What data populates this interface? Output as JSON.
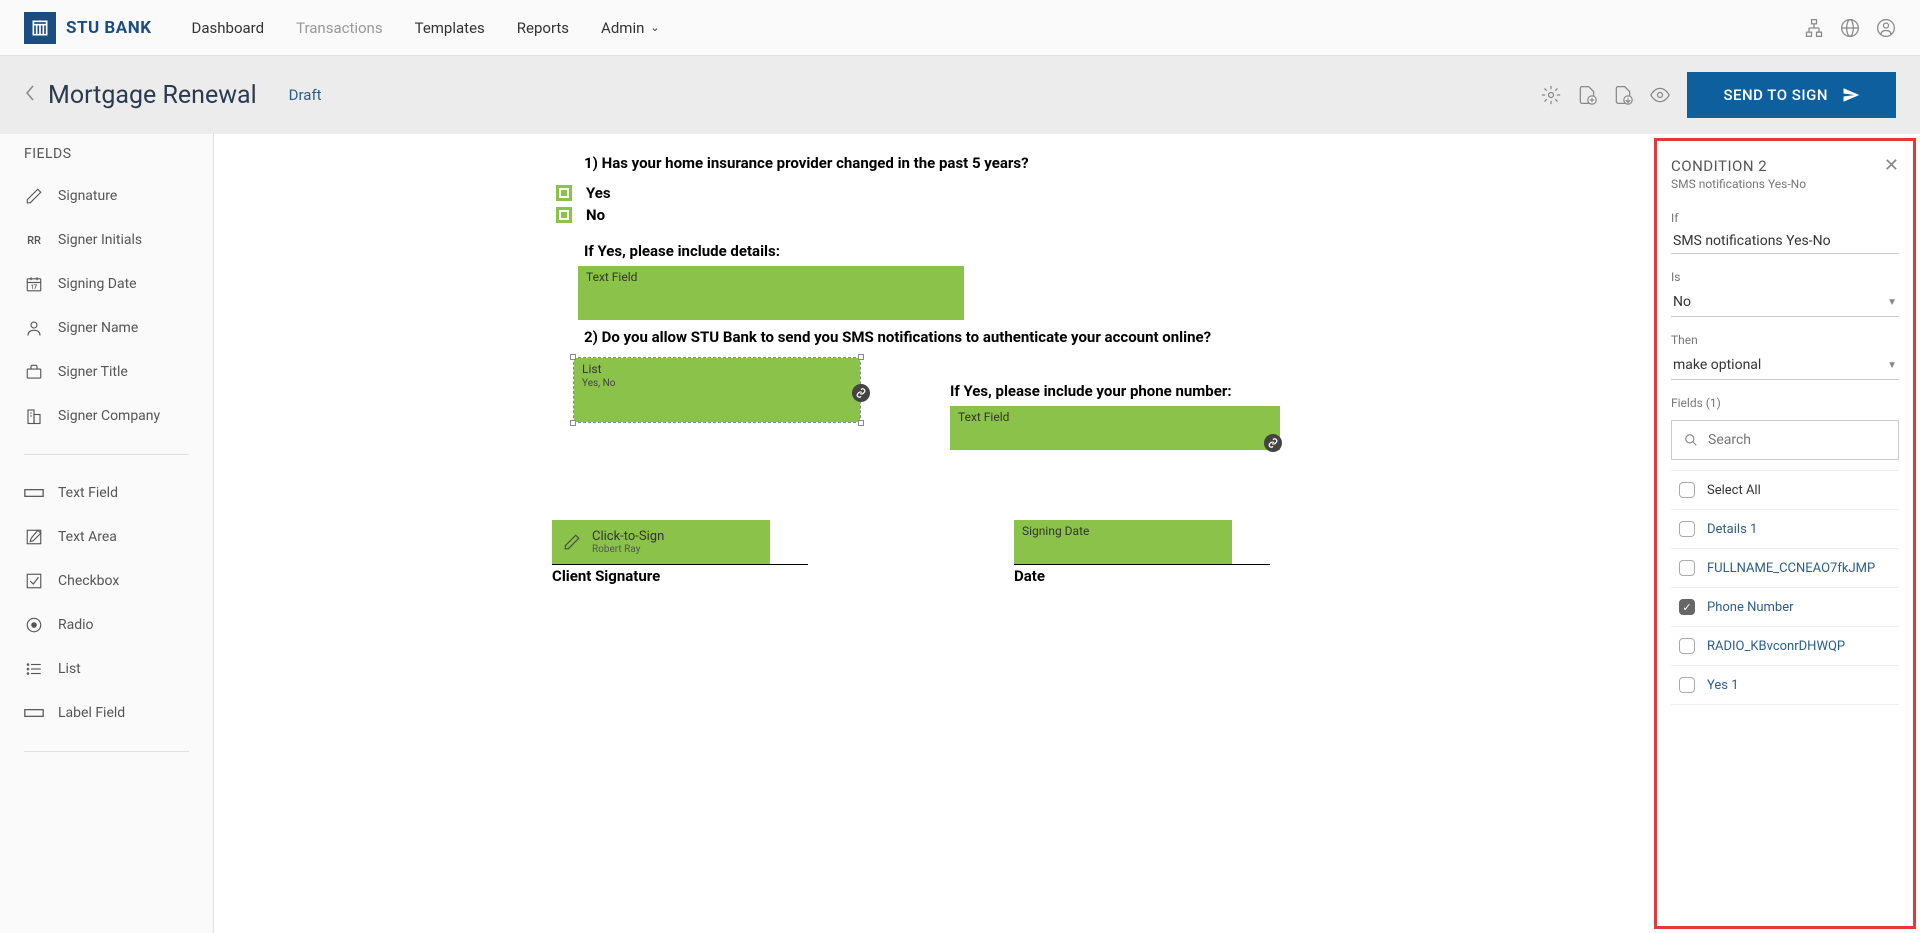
{
  "logo": {
    "text": "STU BANK"
  },
  "nav": {
    "items": [
      "Dashboard",
      "Transactions",
      "Templates",
      "Reports",
      "Admin"
    ],
    "active_index": 1
  },
  "sub_header": {
    "title": "Mortgage Renewal",
    "status": "Draft",
    "send_button": "SEND TO SIGN"
  },
  "sidebar": {
    "header": "FIELDS",
    "group1": [
      {
        "label": "Signature",
        "icon": "pencil"
      },
      {
        "label": "Signer Initials",
        "icon": "initials"
      },
      {
        "label": "Signing Date",
        "icon": "calendar"
      },
      {
        "label": "Signer Name",
        "icon": "person"
      },
      {
        "label": "Signer Title",
        "icon": "briefcase"
      },
      {
        "label": "Signer Company",
        "icon": "company"
      }
    ],
    "group2": [
      {
        "label": "Text Field",
        "icon": "textfield"
      },
      {
        "label": "Text Area",
        "icon": "textarea"
      },
      {
        "label": "Checkbox",
        "icon": "checkbox"
      },
      {
        "label": "Radio",
        "icon": "radio"
      },
      {
        "label": "List",
        "icon": "list"
      },
      {
        "label": "Label Field",
        "icon": "label"
      }
    ]
  },
  "document": {
    "q1": "1)    Has your home insurance provider changed in the past 5 years?",
    "yes": "Yes",
    "no": "No",
    "if_yes_details": "If Yes, please include details:",
    "text_field_label": "Text Field",
    "q2": "2)    Do you allow STU Bank to send you SMS notifications to authenticate your account online?",
    "list_label": "List",
    "list_sub": "Yes, No",
    "if_yes_phone": "If Yes, please include your phone number:",
    "click_to_sign": "Click-to-Sign",
    "signer_name": "Robert Ray",
    "client_signature": "Client Signature",
    "signing_date": "Signing Date",
    "date_label": "Date"
  },
  "panel": {
    "title": "CONDITION 2",
    "subtitle": "SMS notifications Yes-No",
    "if_label": "If",
    "if_value": "SMS notifications Yes-No",
    "is_label": "Is",
    "is_value": "No",
    "then_label": "Then",
    "then_value": "make optional",
    "fields_label": "Fields (1)",
    "search_placeholder": "Search",
    "select_all": "Select All",
    "fields": [
      {
        "label": "Details 1",
        "checked": false
      },
      {
        "label": "FULLNAME_CCNEAO7fkJMP",
        "checked": false
      },
      {
        "label": "Phone Number",
        "checked": true
      },
      {
        "label": "RADIO_KBvconrDHWQP",
        "checked": false
      },
      {
        "label": "Yes 1",
        "checked": false
      }
    ]
  }
}
